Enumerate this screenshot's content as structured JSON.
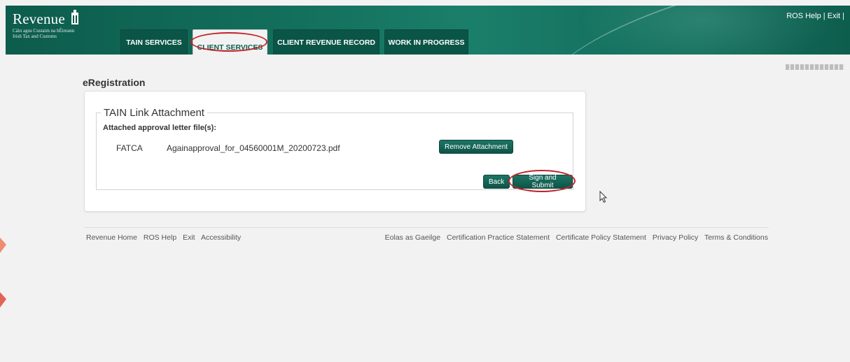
{
  "header": {
    "brand_name": "Revenue",
    "brand_sub_irish": "Cáin agus Custaim na hÉireann",
    "brand_sub_english": "Irish Tax and Customs",
    "top_links": {
      "help": "ROS Help",
      "sep1": " | ",
      "exit": "Exit",
      "sep2": " |"
    }
  },
  "tabs": [
    {
      "label": "TAIN SERVICES",
      "active": false
    },
    {
      "label": "CLIENT SERVICES",
      "active": true
    },
    {
      "label": "CLIENT REVENUE RECORD",
      "active": false
    },
    {
      "label": "WORK IN PROGRESS",
      "active": false
    }
  ],
  "page_title": "eRegistration",
  "attachment": {
    "legend": "TAIN Link Attachment",
    "attached_label": "Attached approval letter file(s):",
    "file_type": "FATCA",
    "file_name": "Againapproval_for_04560001M_20200723.pdf",
    "remove_label": "Remove Attachment",
    "back_label": "Back",
    "sign_label": "Sign and Submit"
  },
  "footer": {
    "left_links": [
      "Revenue Home",
      "ROS Help",
      "Exit",
      "Accessibility"
    ],
    "right_links": [
      "Eolas as Gaeilge",
      "Certification Practice Statement",
      "Certificate Policy Statement",
      "Privacy Policy",
      "Terms & Conditions"
    ]
  },
  "colors": {
    "brand_green": "#0d5c4c",
    "highlight_red": "#c0242b"
  }
}
